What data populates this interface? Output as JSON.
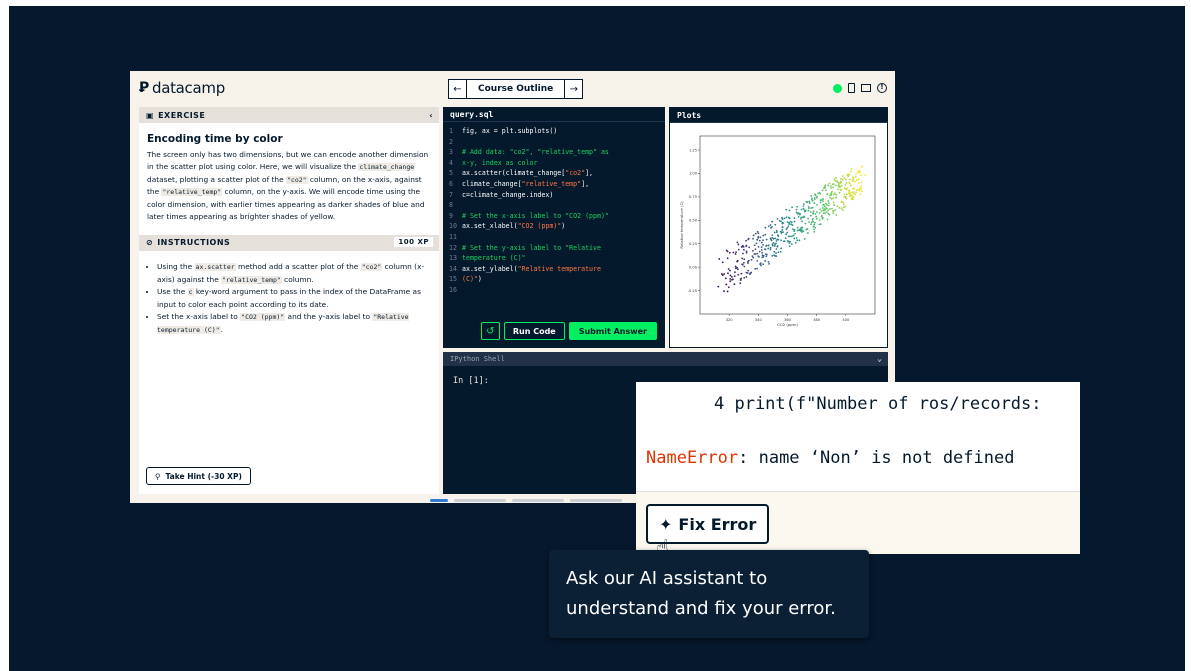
{
  "app": {
    "logo_text": "datacamp",
    "nav": {
      "prev_arrow": "←",
      "outline_label": "Course Outline",
      "next_arrow": "→"
    }
  },
  "exercise": {
    "header": "EXERCISE",
    "collapse": "‹",
    "title": "Encoding time by color",
    "body_parts": [
      "The screen only has two dimensions, but we can encode another dimension in the scatter plot using color. Here, we will visualize the ",
      "climate_change",
      " dataset, plotting a scatter plot of the ",
      "\"co2\"",
      " column, on the x-axis, against the ",
      "\"relative_temp\"",
      " column, on the y-axis. We will encode time using the color dimension, with earlier times appearing as darker shades of blue and later times appearing as brighter shades of yellow."
    ]
  },
  "instructions": {
    "header": "INSTRUCTIONS",
    "xp": "100 XP",
    "items": [
      [
        "Using the ",
        "ax.scatter",
        " method add a scatter plot of the ",
        "\"co2\"",
        " column (x-axis) against the ",
        "\"relative_temp\"",
        " column."
      ],
      [
        "Use the ",
        "c",
        " key-word argument to pass in the index of the DataFrame as input to color each point according to its date."
      ],
      [
        "Set the x-axis label to ",
        "\"CO2 (ppm)\"",
        " and the y-axis label to ",
        "\"Relative temperature (C)\"",
        "."
      ]
    ],
    "hint_label": "Take Hint (-30 XP)"
  },
  "editor": {
    "tab": "query.sql",
    "lines": [
      [
        {
          "t": "fig, ax = plt.subplots()",
          "c": ""
        }
      ],
      [
        {
          "t": "",
          "c": ""
        }
      ],
      [
        {
          "t": "# Add data: \"co2\", \"relative_temp\" as",
          "c": "com"
        }
      ],
      [
        {
          "t": "x-y, index as color",
          "c": "com"
        }
      ],
      [
        {
          "t": "ax.scatter(climate_change[",
          "c": ""
        },
        {
          "t": "\"co2\"",
          "c": "str"
        },
        {
          "t": "],",
          "c": ""
        }
      ],
      [
        {
          "t": "climate_change[",
          "c": ""
        },
        {
          "t": "\"relative_temp\"",
          "c": "str"
        },
        {
          "t": "],",
          "c": ""
        }
      ],
      [
        {
          "t": "c=climate_change.index)",
          "c": ""
        }
      ],
      [
        {
          "t": "",
          "c": ""
        }
      ],
      [
        {
          "t": "# Set the x-axis label to \"CO2 (ppm)\"",
          "c": "com"
        }
      ],
      [
        {
          "t": "ax.set_xlabel(",
          "c": ""
        },
        {
          "t": "\"CO2 (ppm)\"",
          "c": "str"
        },
        {
          "t": ")",
          "c": ""
        }
      ],
      [
        {
          "t": "",
          "c": ""
        }
      ],
      [
        {
          "t": "# Set the y-axis label to \"Relative",
          "c": "com"
        }
      ],
      [
        {
          "t": "temperature (C)\"",
          "c": "com"
        }
      ],
      [
        {
          "t": "ax.set_ylabel(",
          "c": ""
        },
        {
          "t": "\"Relative temperature",
          "c": "str"
        }
      ],
      [
        {
          "t": "(C)\"",
          "c": "str"
        },
        {
          "t": ")",
          "c": ""
        }
      ],
      [
        {
          "t": "",
          "c": ""
        }
      ]
    ],
    "line_numbers": [
      "1",
      "2",
      "3",
      "4",
      "5",
      "6",
      "7",
      "8",
      "9",
      "10",
      "11",
      "12",
      "13",
      "14",
      "15",
      "16"
    ],
    "reset_icon": "↺",
    "run_label": "Run Code",
    "submit_label": "Submit Answer"
  },
  "plots": {
    "tab": "Plots",
    "chart_data": {
      "type": "scatter",
      "xlabel": "CO2 (ppm)",
      "ylabel": "Relative temperature (C)",
      "xlim": [
        300,
        420
      ],
      "ylim": [
        -0.5,
        1.4
      ],
      "xticks": [
        "320",
        "340",
        "360",
        "380",
        "400"
      ],
      "yticks": [
        "-0.25",
        "0.00",
        "0.25",
        "0.50",
        "0.75",
        "1.00",
        "1.25"
      ],
      "colormap": [
        "#440154",
        "#3b528b",
        "#21918c",
        "#5ec962",
        "#fde725"
      ],
      "trend": {
        "x_start": 315,
        "x_end": 410,
        "y_start": -0.1,
        "y_end": 0.95
      }
    }
  },
  "shell": {
    "tab": "IPython Shell",
    "chevron": "⌄",
    "prompt": "In [1]:"
  },
  "zoom": {
    "code_line": "4 print(f\"Number of ros/records:",
    "error_name": "NameError",
    "error_msg": ": name ‘Non’ is not defined",
    "fix_label": "Fix Error"
  },
  "tooltip": {
    "text_line1": "Ask our AI assistant to",
    "text_line2": "understand and fix your error."
  }
}
